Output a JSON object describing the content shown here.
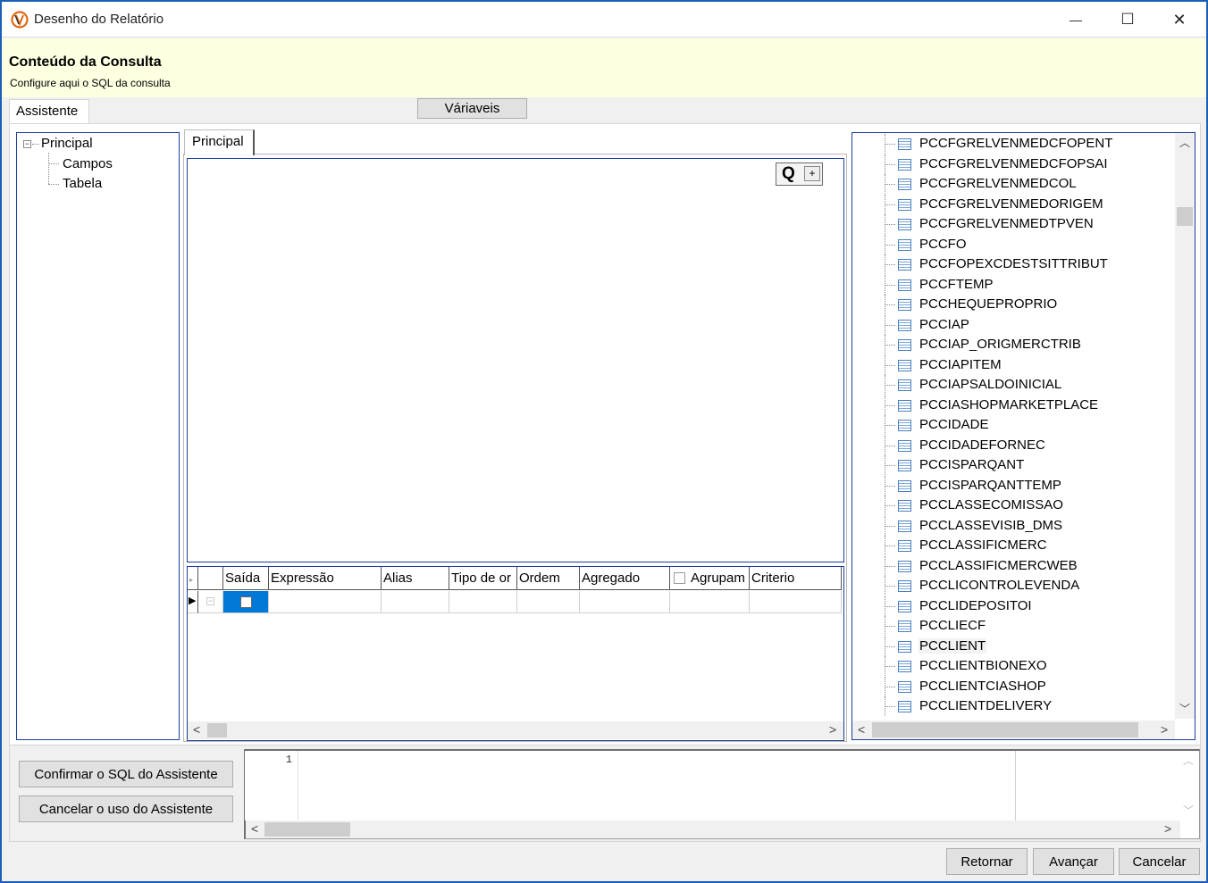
{
  "window": {
    "title": "Desenho do Relatório",
    "minimize": "—",
    "maximize": "☐",
    "close": "✕"
  },
  "header": {
    "title": "Conteúdo da Consulta",
    "subtitle": "Configure aqui o SQL da consulta"
  },
  "tabs": {
    "assistente": "Assistente",
    "variaveis_button": "Váriaveis"
  },
  "tree": {
    "root": "Principal",
    "children": [
      "Campos",
      "Tabela"
    ]
  },
  "designer": {
    "tab": "Principal",
    "query_button": "Q",
    "add_button": "+"
  },
  "grid": {
    "columns": [
      "Saída",
      "Expressão",
      "Alias",
      "Tipo de or",
      "Ordem",
      "Agregado",
      "Agrupam",
      "Criterio"
    ]
  },
  "table_list": {
    "items": [
      "PCCFGRELVENMEDCFOPENT",
      "PCCFGRELVENMEDCFOPSAI",
      "PCCFGRELVENMEDCOL",
      "PCCFGRELVENMEDORIGEM",
      "PCCFGRELVENMEDTPVEN",
      "PCCFO",
      "PCCFOPEXCDESTSITTRIBUT",
      "PCCFTEMP",
      "PCCHEQUEPROPRIO",
      "PCCIAP",
      "PCCIAP_ORIGMERCTRIB",
      "PCCIAPITEM",
      "PCCIAPSALDOINICIAL",
      "PCCIASHOPMARKETPLACE",
      "PCCIDADE",
      "PCCIDADEFORNEC",
      "PCCISPARQANT",
      "PCCISPARQANTTEMP",
      "PCCLASSECOMISSAO",
      "PCCLASSEVISIB_DMS",
      "PCCLASSIFICMERC",
      "PCCLASSIFICMERCWEB",
      "PCCLICONTROLEVENDA",
      "PCCLIDEPOSITOI",
      "PCCLIECF",
      "PCCLIENT",
      "PCCLIENTBIONEXO",
      "PCCLIENTCIASHOP",
      "PCCLIENTDELIVERY"
    ],
    "selected": "PCCLIENT"
  },
  "assistant_buttons": {
    "confirm": "Confirmar o  SQL do Assistente",
    "cancel": "Cancelar o uso do Assistente"
  },
  "editor": {
    "line_number": "1"
  },
  "footer": {
    "back": "Retornar",
    "next": "Avançar",
    "cancel": "Cancelar"
  },
  "colors": {
    "header_bg": "#ffffe1",
    "window_border": "#1c5fb8",
    "panel_border": "#1c3e9b"
  }
}
